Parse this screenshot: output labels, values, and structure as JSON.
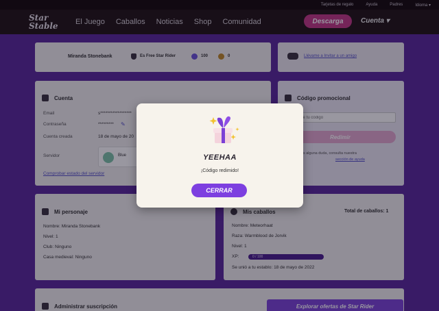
{
  "topbar": {
    "items": [
      "Tarjetas de regalo",
      "Ayuda",
      "Padres",
      "Idioma ▾"
    ]
  },
  "nav": {
    "logo_line1": "Star",
    "logo_line2": "Stable",
    "links": [
      "El Juego",
      "Caballos",
      "Noticias",
      "Shop",
      "Comunidad"
    ],
    "download": "Descarga",
    "account": "Cuenta"
  },
  "profile_bar": {
    "name": "Miranda Stonebank",
    "rider_status": "Es Free Star Rider",
    "star_coins": "100",
    "jorvik_shillings": "0"
  },
  "invite": {
    "link": "Llévame a Invitar a un amigo"
  },
  "account_card": {
    "title": "Cuenta",
    "email_label": "Email",
    "email_value": "s******************",
    "password_label": "Contraseña",
    "password_value": "*********",
    "created_label": "Cuenta creada",
    "created_value": "18 de mayo de 20",
    "server_label": "Servidor",
    "server_name": "Blue",
    "server_link": "Comprobar estado del servidor"
  },
  "promo": {
    "title": "Código promocional",
    "placeholder": "Introduce tu código",
    "button": "Redimir",
    "help_text": "¿Tienes alguna duda, consulta nuestra",
    "help_link": "sección de ayuda"
  },
  "character": {
    "title": "Mi personaje",
    "name": "Nombre: Miranda Stonebank",
    "level": "Nivel: 1",
    "club": "Club: Ninguno",
    "house": "Casa medieval: Ninguno"
  },
  "horses": {
    "title": "Mis caballos",
    "total": "Total de caballos: 1",
    "name": "Nombre: Meteorhaat",
    "breed": "Raza: Warmblood de Jorvik",
    "level": "Nivel: 1",
    "xp_label": "XP:",
    "xp_value": "0 / 100",
    "xp_progress": 0,
    "stable_note": "Se unió a tu establo: 18 de mayo de 2022"
  },
  "subscription": {
    "title": "Administrar suscripción",
    "button": "Explorar ofertas de Star Rider"
  },
  "modal": {
    "title": "YEEHAA",
    "message": "¡Código redimido!",
    "button": "CERRAR"
  }
}
